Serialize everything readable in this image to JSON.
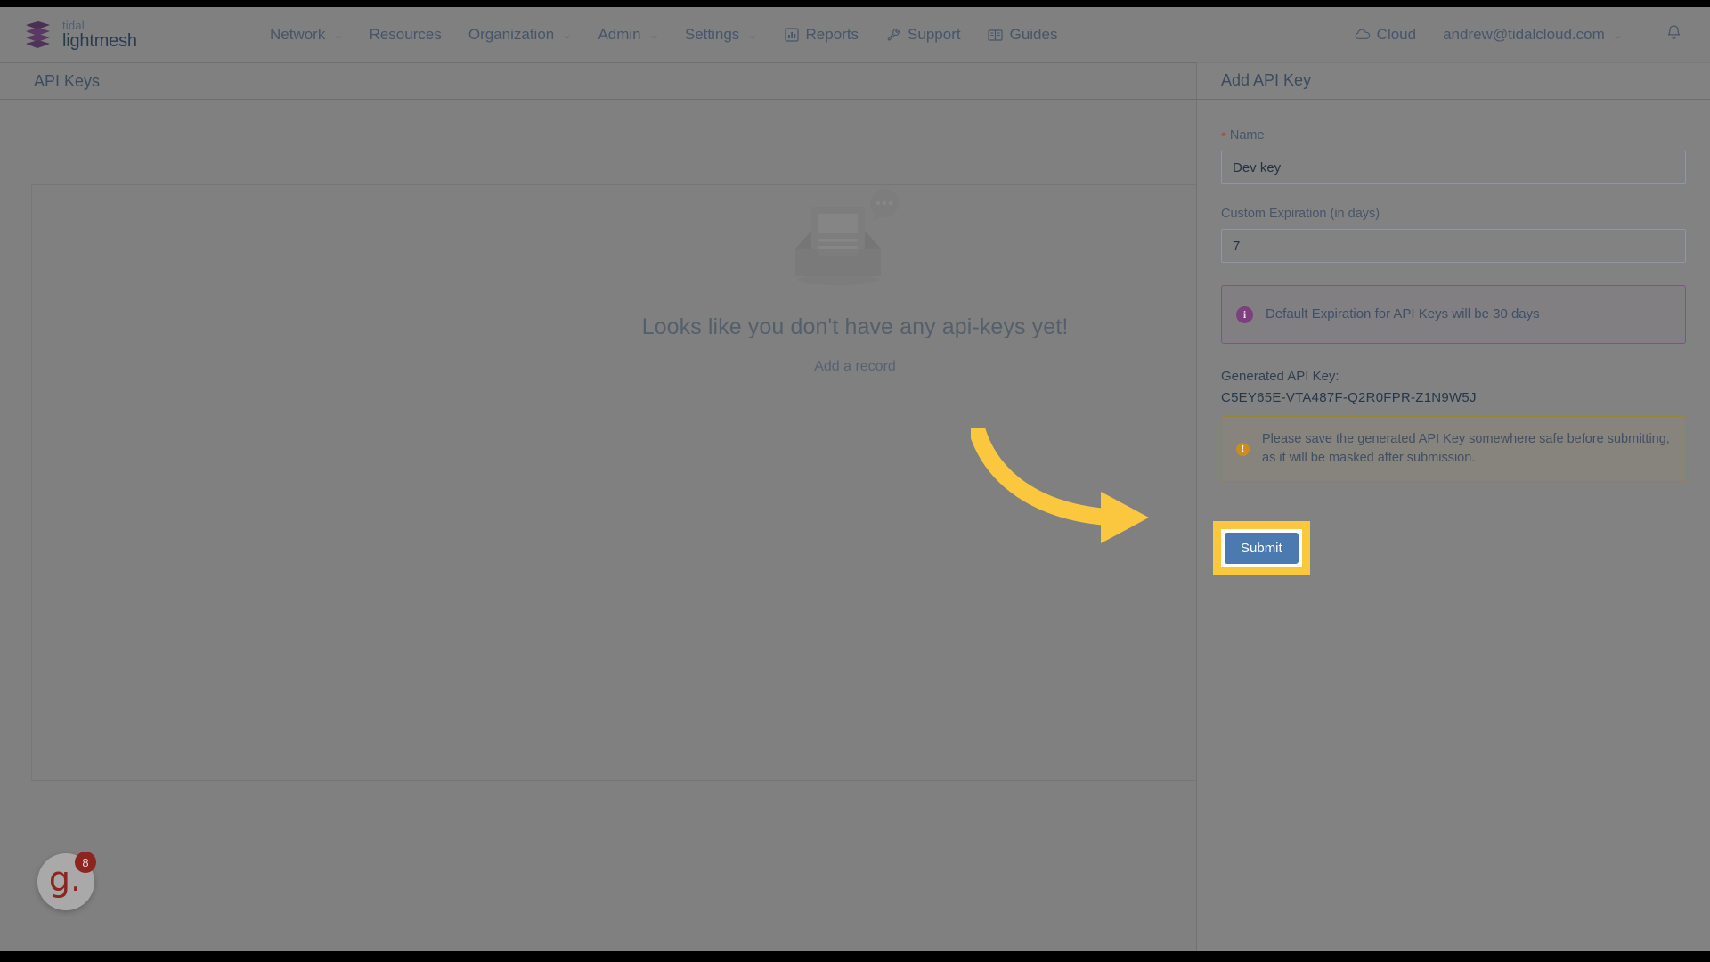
{
  "brand": {
    "line1": "tidal",
    "line2": "lightmesh",
    "logo_icon": "stacked-layers-logo"
  },
  "navbar": {
    "items": [
      {
        "label": "Network",
        "icon": null,
        "has_caret": true
      },
      {
        "label": "Resources",
        "icon": null,
        "has_caret": false
      },
      {
        "label": "Organization",
        "icon": null,
        "has_caret": true
      },
      {
        "label": "Admin",
        "icon": null,
        "has_caret": true
      },
      {
        "label": "Settings",
        "icon": null,
        "has_caret": true
      },
      {
        "label": "Reports",
        "icon": "bar-chart-icon",
        "has_caret": false
      },
      {
        "label": "Support",
        "icon": "wrench-icon",
        "has_caret": false
      },
      {
        "label": "Guides",
        "icon": "book-icon",
        "has_caret": false
      }
    ],
    "right": [
      {
        "label": "Cloud",
        "icon": "cloud-icon",
        "has_caret": false
      },
      {
        "label": "andrew@tidalcloud.com",
        "icon": null,
        "has_caret": true
      }
    ],
    "notification_icon": "bell-icon"
  },
  "page": {
    "title": "API Keys"
  },
  "empty_state": {
    "illustration": "empty-inbox-illustration",
    "title": "Looks like you don't have any api-keys yet!",
    "link": "Add a record"
  },
  "drawer": {
    "title": "Add API Key",
    "name_field": {
      "label": "Name",
      "required_marker": "*",
      "value": "Dev key",
      "placeholder": ""
    },
    "expiration_field": {
      "label": "Custom Expiration (in days)",
      "value": "7",
      "placeholder": ""
    },
    "info_alert": {
      "icon": "info-icon",
      "icon_glyph": "i",
      "text": "Default Expiration for API Keys will be 30 days",
      "border_color": "#8a4d8a"
    },
    "generated_key": {
      "label": "Generated API Key:",
      "value": "C5EY65E-VTA487F-Q2R0FPR-Z1N9W5J"
    },
    "warning_alert": {
      "icon": "warning-icon",
      "icon_glyph": "!",
      "text": "Please save the generated API Key somewhere safe before submitting, as it will be masked after submission.",
      "border_color": "#9a8434"
    },
    "submit_label": "Submit",
    "submit_color": "#4a7ab0",
    "highlight_color": "#FBC73F"
  },
  "chat_widget": {
    "logo_text": "g.",
    "badge_count": "8",
    "color": "#8e2420"
  },
  "annotation": {
    "arrow_color": "#FBC73F",
    "arrow_icon": "curved-arrow-pointing-right"
  }
}
